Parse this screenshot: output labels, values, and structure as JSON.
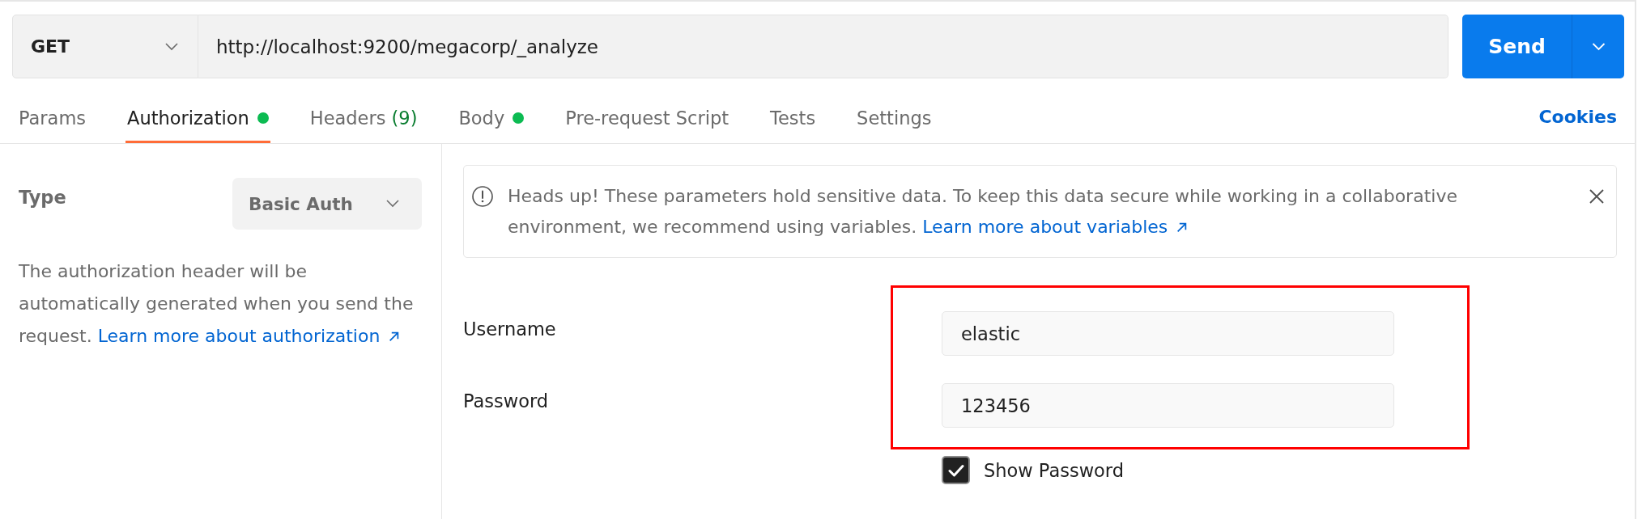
{
  "request": {
    "method": "GET",
    "url": "http://localhost:9200/megacorp/_analyze",
    "send_label": "Send"
  },
  "tabs": [
    {
      "label": "Params",
      "selected": false,
      "dot": false
    },
    {
      "label": "Authorization",
      "selected": true,
      "dot": true
    },
    {
      "label": "Headers",
      "count": "(9)",
      "selected": false,
      "dot": false
    },
    {
      "label": "Body",
      "selected": false,
      "dot": true
    },
    {
      "label": "Pre-request Script",
      "selected": false,
      "dot": false
    },
    {
      "label": "Tests",
      "selected": false,
      "dot": false
    },
    {
      "label": "Settings",
      "selected": false,
      "dot": false
    }
  ],
  "cookies_link": "Cookies",
  "auth": {
    "type_label": "Type",
    "type_value": "Basic Auth",
    "description": "The authorization header will be automatically generated when you send the request.",
    "description_link": "Learn more about authorization"
  },
  "alert": {
    "message": "Heads up! These parameters hold sensitive data. To keep this data secure while working in a collaborative environment, we recommend using variables.",
    "link": "Learn more about variables"
  },
  "credentials": {
    "highlighted": true,
    "fields": [
      {
        "label": "Username",
        "value": "elastic"
      },
      {
        "label": "Password",
        "value": "123456"
      }
    ],
    "show_password": {
      "label": "Show Password",
      "checked": true
    }
  }
}
